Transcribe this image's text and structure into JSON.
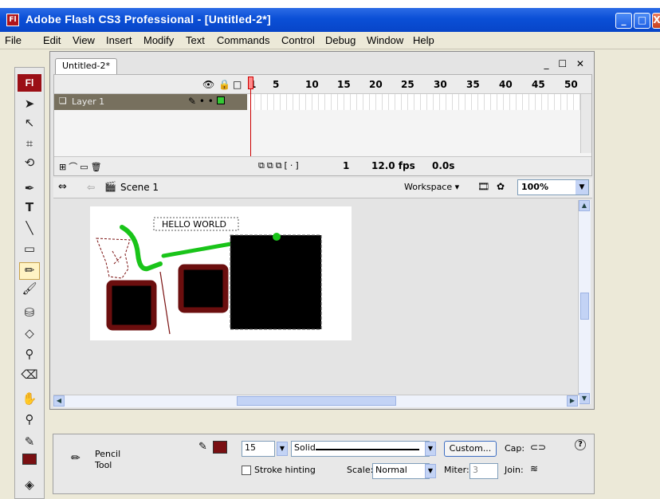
{
  "window": {
    "app_icon": "Fl",
    "title": "Adobe Flash CS3 Professional - [Untitled-2*]",
    "min_label": "_",
    "max_label": "□",
    "close_label": "X"
  },
  "menu": [
    "File",
    "Edit",
    "View",
    "Insert",
    "Modify",
    "Text",
    "Commands",
    "Control",
    "Debug",
    "Window",
    "Help"
  ],
  "toolbar": {
    "logo": "Fl",
    "tools": [
      {
        "name": "selection-tool",
        "glyph": "➤"
      },
      {
        "name": "subselection-tool",
        "glyph": "↖"
      },
      {
        "name": "free-transform-tool",
        "glyph": "⌗"
      },
      {
        "name": "lasso-tool",
        "glyph": "⟲"
      },
      {
        "name": "pen-tool",
        "glyph": "✒"
      },
      {
        "name": "text-tool",
        "glyph": "T"
      },
      {
        "name": "line-tool",
        "glyph": "╲"
      },
      {
        "name": "rectangle-tool",
        "glyph": "▭"
      },
      {
        "name": "pencil-tool",
        "glyph": "✏"
      },
      {
        "name": "brush-tool",
        "glyph": "🖌"
      },
      {
        "name": "ink-bottle-tool",
        "glyph": "⛁"
      },
      {
        "name": "paint-bucket-tool",
        "glyph": "◇"
      },
      {
        "name": "eyedropper-tool",
        "glyph": "⚲"
      },
      {
        "name": "eraser-tool",
        "glyph": "⌫"
      },
      {
        "name": "hand-tool",
        "glyph": "✋"
      },
      {
        "name": "zoom-tool",
        "glyph": "⚲"
      },
      {
        "name": "stroke-color-tool",
        "glyph": "✎"
      }
    ],
    "active_tool": "pencil-tool",
    "stroke_color": "#7a0f12"
  },
  "document": {
    "tab_label": "Untitled-2*",
    "ctrl_label": "_ ☐ ✕"
  },
  "timeline": {
    "frame_numbers": [
      "1",
      "5",
      "10",
      "15",
      "20",
      "25",
      "30",
      "35",
      "40",
      "45",
      "50"
    ],
    "layer_name": "Layer 1",
    "current_frame": "1",
    "fps": "12.0 fps",
    "time": "0.0s"
  },
  "editbar": {
    "scene_label": "Scene 1",
    "workspace_label": "Workspace ▾",
    "zoom": "100%"
  },
  "stage": {
    "text_object": "HELLO WORLD",
    "colors": {
      "green": "#19c419",
      "maroon": "#6b0e0e",
      "black": "#000000"
    }
  },
  "properties": {
    "tool_name": "Pencil",
    "tool_sub": "Tool",
    "stroke_color": "#7a0f12",
    "stroke_height": "15",
    "stroke_style": "Solid",
    "custom_label": "Custom...",
    "cap_label": "Cap:",
    "stroke_hinting_label": "Stroke hinting",
    "scale_label": "Scale:",
    "scale_value": "Normal",
    "miter_label": "Miter:",
    "miter_value": "3",
    "join_label": "Join:"
  }
}
